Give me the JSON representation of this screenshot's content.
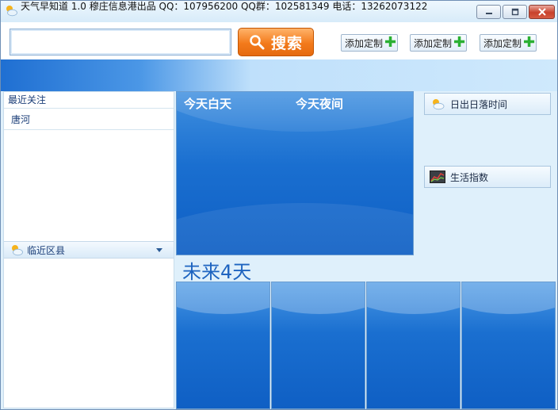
{
  "window": {
    "title": "天气早知道 1.0   穆庄信息港出品 QQ：107956200 QQ群：102581349 电话：13262073122",
    "app_icon": "sun-cloud-icon",
    "controls": {
      "minimize_icon": "minimize-icon",
      "maximize_icon": "maximize-icon",
      "close_icon": "close-icon"
    }
  },
  "search": {
    "value": "",
    "button_label": "搜索",
    "button_icon": "magnifier-icon"
  },
  "custom_buttons": [
    {
      "label": "添加定制",
      "icon": "plus-icon"
    },
    {
      "label": "添加定制",
      "icon": "plus-icon"
    },
    {
      "label": "添加定制",
      "icon": "plus-icon"
    }
  ],
  "left_panel": {
    "recent_title": "最近关注",
    "recent_items": [
      "唐河"
    ],
    "nearby_label": "临近区县",
    "nearby_icon": "sun-cloud-icon"
  },
  "today": {
    "day_label": "今天白天",
    "night_label": "今天夜间"
  },
  "widgets": {
    "sunrise_label": "日出日落时间",
    "sunrise_icon": "sun-cloud-icon",
    "life_label": "生活指数",
    "life_icon": "chart-icon"
  },
  "future": {
    "title": "未来4天"
  },
  "colors": {
    "accent_orange": "#f37a1b",
    "panel_blue": "#1a6fd0",
    "title_blue": "#1e64c0",
    "plus_green": "#2bb032"
  }
}
